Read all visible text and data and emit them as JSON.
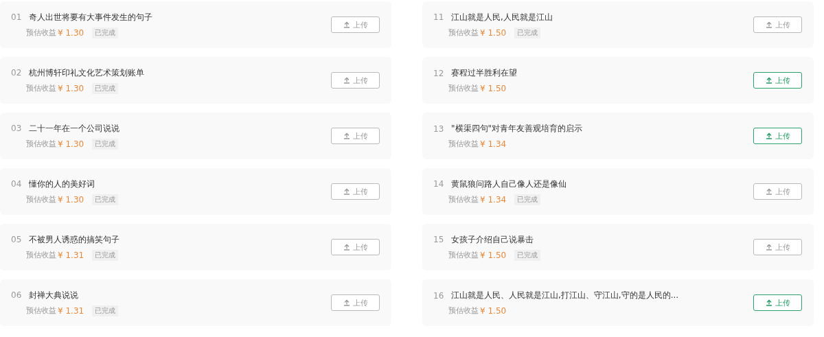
{
  "tasks": [
    {
      "number": "01",
      "title": "奇人出世将要有大事件发生的句子",
      "earnings_label": "预估收益",
      "price": "¥ 1.30",
      "status": "已完成",
      "button": {
        "label": "上传",
        "active": false
      }
    },
    {
      "number": "02",
      "title": "杭州博轩印礼文化艺术策划账单",
      "earnings_label": "预估收益",
      "price": "¥ 1.30",
      "status": "已完成",
      "button": {
        "label": "上传",
        "active": false
      }
    },
    {
      "number": "03",
      "title": "二十一年在一个公司说说",
      "earnings_label": "预估收益",
      "price": "¥ 1.30",
      "status": "已完成",
      "button": {
        "label": "上传",
        "active": false
      }
    },
    {
      "number": "04",
      "title": "懂你的人的美好词",
      "earnings_label": "预估收益",
      "price": "¥ 1.30",
      "status": "已完成",
      "button": {
        "label": "上传",
        "active": false
      }
    },
    {
      "number": "05",
      "title": "不被男人诱惑的搞笑句子",
      "earnings_label": "预估收益",
      "price": "¥ 1.31",
      "status": "已完成",
      "button": {
        "label": "上传",
        "active": false
      }
    },
    {
      "number": "06",
      "title": "封禅大典说说",
      "earnings_label": "预估收益",
      "price": "¥ 1.31",
      "status": "已完成",
      "button": {
        "label": "上传",
        "active": false
      }
    },
    {
      "number": "11",
      "title": "江山就是人民,人民就是江山",
      "earnings_label": "预估收益",
      "price": "¥ 1.50",
      "status": "已完成",
      "button": {
        "label": "上传",
        "active": false
      }
    },
    {
      "number": "12",
      "title": "赛程过半胜利在望",
      "earnings_label": "预估收益",
      "price": "¥ 1.50",
      "button": {
        "label": "上传",
        "active": true
      }
    },
    {
      "number": "13",
      "title": "\"横渠四句\"对青年友善观培育的启示",
      "earnings_label": "预估收益",
      "price": "¥ 1.34",
      "button": {
        "label": "上传",
        "active": true
      }
    },
    {
      "number": "14",
      "title": "黄鼠狼问路人自己像人还是像仙",
      "earnings_label": "预估收益",
      "price": "¥ 1.34",
      "status": "已完成",
      "button": {
        "label": "上传",
        "active": false
      }
    },
    {
      "number": "15",
      "title": "女孩子介绍自己说暴击",
      "earnings_label": "预估收益",
      "price": "¥ 1.50",
      "status": "已完成",
      "button": {
        "label": "上传",
        "active": false
      }
    },
    {
      "number": "16",
      "title": "江山就是人民、人民就是江山,打江山、守江山,守的是人民的...",
      "earnings_label": "预估收益",
      "price": "¥ 1.50",
      "button": {
        "label": "上传",
        "active": true
      }
    }
  ]
}
